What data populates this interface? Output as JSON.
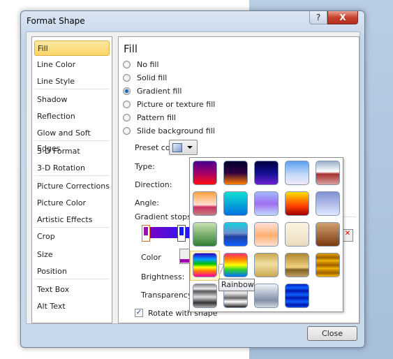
{
  "dialog": {
    "title": "Format Shape",
    "help_label": "?",
    "close_icon_label": "X",
    "close_button": "Close"
  },
  "sidebar": {
    "items": [
      {
        "label": "Fill",
        "selected": true
      },
      {
        "label": "Line Color"
      },
      {
        "label": "Line Style"
      },
      {
        "label": "Shadow"
      },
      {
        "label": "Reflection"
      },
      {
        "label": "Glow and Soft Edges"
      },
      {
        "label": "3-D Format"
      },
      {
        "label": "3-D Rotation"
      },
      {
        "label": "Picture Corrections"
      },
      {
        "label": "Picture Color"
      },
      {
        "label": "Artistic Effects"
      },
      {
        "label": "Crop"
      },
      {
        "label": "Size"
      },
      {
        "label": "Position"
      },
      {
        "label": "Text Box"
      },
      {
        "label": "Alt Text"
      }
    ]
  },
  "fill": {
    "heading": "Fill",
    "options": [
      {
        "label": "No fill"
      },
      {
        "label": "Solid fill"
      },
      {
        "label": "Gradient fill",
        "checked": true
      },
      {
        "label": "Picture or texture fill"
      },
      {
        "label": "Pattern fill"
      },
      {
        "label": "Slide background fill"
      }
    ],
    "preset_label": "Preset colors:",
    "type_label": "Type:",
    "direction_label": "Direction:",
    "angle_label": "Angle:",
    "stops_label": "Gradient stops",
    "color_label": "Color",
    "brightness_label": "Brightness:",
    "transparency_label": "Transparency",
    "rotate_label": "Rotate with shape",
    "rotate_checked": true
  },
  "preset_popup": {
    "hovered": "Rainbow",
    "tooltip": "Rainbow"
  }
}
